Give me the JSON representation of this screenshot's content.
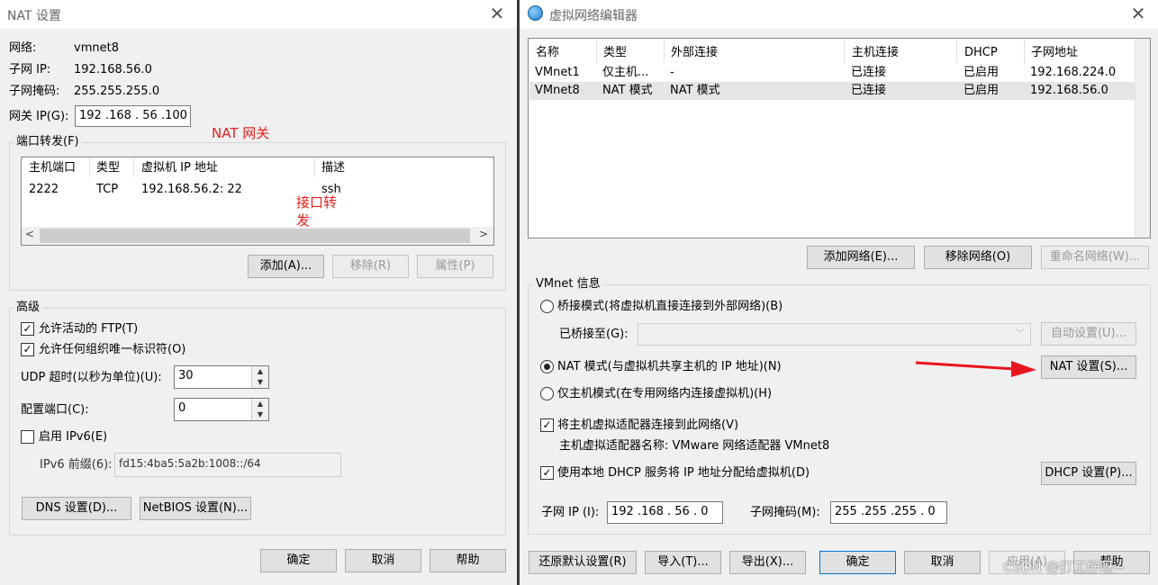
{
  "nat": {
    "title": "NAT 设置",
    "network_label": "网络:",
    "network_value": "vmnet8",
    "subnet_ip_label": "子网 IP:",
    "subnet_ip_value": "192.168.56.0",
    "subnet_mask_label": "子网掩码:",
    "subnet_mask_value": "255.255.255.0",
    "gateway_label": "网关 IP(G):",
    "gateway_value": "192 .168 . 56 .100",
    "gateway_annotation": "NAT 网关",
    "port_forwarding": {
      "group_title": "端口转发(F)",
      "columns": [
        "主机端口",
        "类型",
        "虚拟机 IP 地址",
        "描述"
      ],
      "rows": [
        [
          "2222",
          "TCP",
          "192.168.56.2: 22",
          "ssh"
        ]
      ],
      "annotation_line1": "接口转",
      "annotation_line2": "发",
      "add_button": "添加(A)...",
      "remove_button": "移除(R)",
      "properties_button": "属性(P)"
    },
    "advanced": {
      "group_title": "高级",
      "allow_ftp": "允许活动的 FTP(T)",
      "allow_oui": "允许任何组织唯一标识符(O)",
      "udp_label": "UDP 超时(以秒为单位)(U):",
      "udp_value": "30",
      "config_port_label": "配置端口(C):",
      "config_port_value": "0",
      "enable_ipv6": "启用 IPv6(E)",
      "ipv6_prefix_label": "IPv6 前缀(6):",
      "ipv6_prefix_value": "fd15:4ba5:5a2b:1008::/64",
      "dns_button": "DNS 设置(D)...",
      "netbios_button": "NetBIOS 设置(N)..."
    },
    "ok_button": "确定",
    "cancel_button": "取消",
    "help_button": "帮助"
  },
  "vne": {
    "title": "虚拟网络编辑器",
    "table": {
      "columns": [
        "名称",
        "类型",
        "外部连接",
        "主机连接",
        "DHCP",
        "子网地址"
      ],
      "rows": [
        [
          "VMnet1",
          "仅主机...",
          "-",
          "已连接",
          "已启用",
          "192.168.224.0"
        ],
        [
          "VMnet8",
          "NAT 模式",
          "NAT 模式",
          "已连接",
          "已启用",
          "192.168.56.0"
        ]
      ]
    },
    "add_network_button": "添加网络(E)...",
    "remove_network_button": "移除网络(O)",
    "rename_network_button": "重命名网络(W)...",
    "info": {
      "group_title": "VMnet 信息",
      "bridged_mode": "桥接模式(将虚拟机直接连接到外部网络)(B)",
      "bridged_to_label": "已桥接至(G):",
      "auto_settings_button": "自动设置(U)...",
      "nat_mode": "NAT 模式(与虚拟机共享主机的 IP 地址)(N)",
      "nat_settings_button": "NAT 设置(S)...",
      "host_only_mode": "仅主机模式(在专用网络内连接虚拟机)(H)",
      "connect_adapter": "将主机虚拟适配器连接到此网络(V)",
      "adapter_name_text": "主机虚拟适配器名称: VMware 网络适配器 VMnet8",
      "use_dhcp": "使用本地 DHCP 服务将 IP 地址分配给虚拟机(D)",
      "dhcp_settings_button": "DHCP 设置(P)...",
      "subnet_ip_label": "子网 IP (I):",
      "subnet_ip_value": "192 .168 . 56 .  0",
      "subnet_mask_label": "子网掩码(M):",
      "subnet_mask_value": "255 .255 .255 .  0"
    },
    "restore_defaults_button": "还原默认设置(R)",
    "import_button": "导入(T)...",
    "export_button": "导出(X)...",
    "ok_button": "确定",
    "cancel_button": "取消",
    "apply_button": "应用(A)",
    "help_button": "帮助",
    "watermark": "CSDN @打工仔呀~"
  },
  "colors": {
    "annotation_red": "#e02020",
    "arrow_red": "#e8141e",
    "selected_row": "#e5e5e5",
    "disabled_text": "#999999"
  }
}
